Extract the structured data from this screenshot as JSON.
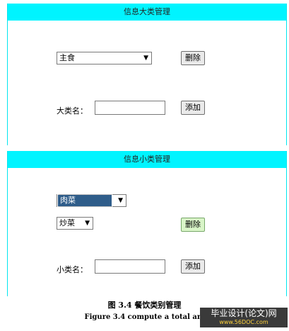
{
  "category": {
    "header": "信息大类管理",
    "select_value": "主食",
    "delete_label": "删除",
    "name_label": "大类名：",
    "add_label": "添加",
    "input_value": ""
  },
  "subcategory": {
    "header": "信息小类管理",
    "select1_value": "肉菜",
    "select2_value": "炒菜",
    "delete_label": "删除",
    "name_label": "小类名：",
    "add_label": "添加",
    "input_value": ""
  },
  "caption": {
    "zh": "图 3.4  餐饮类别管理",
    "en": "Figure 3.4 compute a total am"
  },
  "watermark": {
    "text": "毕业设计(论文)网",
    "url": "www.56DOC.com"
  },
  "icons": {
    "dropdown": "chevron-down-icon"
  },
  "colors": {
    "header_bg": "#00f4ff",
    "selection_bg": "#2f5d8a"
  }
}
